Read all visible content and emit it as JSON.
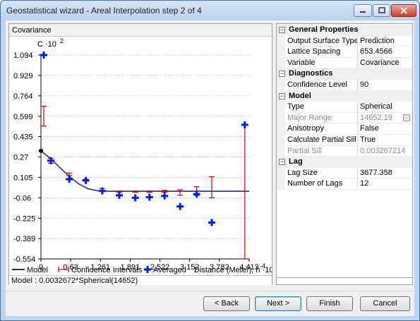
{
  "window": {
    "title": "Geostatistical wizard - Areal Interpolation step 2 of 4"
  },
  "graph": {
    "header": "Covariance",
    "y_axis_label": "C ·10",
    "y_axis_exponent": "2",
    "x_axis_label": "Distance (Meter), h ·10",
    "x_axis_exponent": "-4",
    "legend": {
      "model": "Model",
      "confidence": "Confidence Intervals",
      "averaged": "Averaged"
    },
    "model_formula": "Model : 0.0032672*Spherical(14652)"
  },
  "chart_data": {
    "type": "scatter",
    "title": "",
    "xlabel": "Distance (Meter), h ·10-4",
    "ylabel": "C ·10²",
    "xlim": [
      0,
      4.413
    ],
    "ylim": [
      -0.554,
      1.094
    ],
    "x_ticks": [
      "0",
      "0.63",
      "1.261",
      "1.891",
      "2.522",
      "3.152",
      "3.782",
      "4.413"
    ],
    "x_tick_values": [
      0,
      0.63,
      1.261,
      1.891,
      2.522,
      3.152,
      3.782,
      4.413
    ],
    "y_ticks": [
      "1.094",
      "0.929",
      "0.764",
      "0.599",
      "0.435",
      "0.27",
      "0.105",
      "-0.06",
      "-0.225",
      "-0.389",
      "-0.554"
    ],
    "y_tick_values": [
      1.094,
      0.929,
      0.764,
      0.599,
      0.435,
      0.27,
      0.105,
      -0.06,
      -0.225,
      -0.389,
      -0.554
    ],
    "grid": "horizontal dotted",
    "legend_position": "bottom",
    "model": {
      "name": "Model",
      "nugget_point": [
        0,
        0.32
      ],
      "partial_sill": 0.3267,
      "range": 1.465,
      "x": [
        0,
        0.2,
        0.4,
        0.6,
        0.8,
        1.0,
        1.2,
        1.465,
        4.413
      ],
      "y": [
        0.32,
        0.258,
        0.185,
        0.113,
        0.053,
        0.013,
        -0.003,
        -0.007,
        -0.007
      ]
    },
    "averaged": {
      "name": "Averaged",
      "x": [
        0.06,
        0.21,
        0.6,
        0.95,
        1.3,
        1.66,
        2.0,
        2.3,
        2.62,
        2.95,
        3.3,
        3.62,
        4.32
      ],
      "y": [
        1.094,
        0.24,
        0.09,
        0.08,
        -0.005,
        -0.04,
        -0.06,
        -0.055,
        -0.045,
        -0.13,
        -0.03,
        -0.26,
        0.53
      ]
    },
    "confidence_intervals": {
      "name": "Confidence Intervals",
      "x": [
        0.06,
        0.21,
        0.6,
        0.95,
        1.3,
        1.66,
        2.0,
        2.3,
        2.62,
        2.95,
        3.3,
        3.62,
        4.32
      ],
      "low": [
        0.52,
        0.22,
        0.12,
        0.08,
        -0.005,
        -0.015,
        -0.015,
        -0.015,
        -0.015,
        -0.04,
        -0.04,
        -0.06,
        -0.554
      ],
      "high": [
        0.68,
        0.26,
        0.14,
        0.09,
        0.015,
        -0.005,
        -0.005,
        -0.005,
        0.0,
        0.005,
        0.03,
        0.11,
        0.53
      ]
    }
  },
  "properties": {
    "categories": [
      {
        "label": "General Properties",
        "rows": [
          {
            "name": "Output Surface Type",
            "value": "Prediction"
          },
          {
            "name": "Lattice Spacing",
            "value": "653.4566"
          },
          {
            "name": "Variable",
            "value": "Covariance"
          }
        ]
      },
      {
        "label": "Diagnostics",
        "rows": [
          {
            "name": "Confidence Level",
            "value": "90"
          }
        ]
      },
      {
        "label": "Model",
        "rows": [
          {
            "name": "Type",
            "value": "Spherical"
          },
          {
            "name": "Major Range",
            "value": "14652.19"
          },
          {
            "name": "Anisotropy",
            "value": "False"
          },
          {
            "name": "Calculate Partial Sill",
            "value": "True"
          },
          {
            "name": "Partial Sill",
            "value": "0.003267214"
          }
        ]
      },
      {
        "label": "Lag",
        "rows": [
          {
            "name": "Lag Size",
            "value": "3677.358"
          },
          {
            "name": "Number of Lags",
            "value": "12"
          }
        ]
      }
    ]
  },
  "buttons": {
    "back": "< Back",
    "next": "Next >",
    "finish": "Finish",
    "cancel": "Cancel"
  }
}
